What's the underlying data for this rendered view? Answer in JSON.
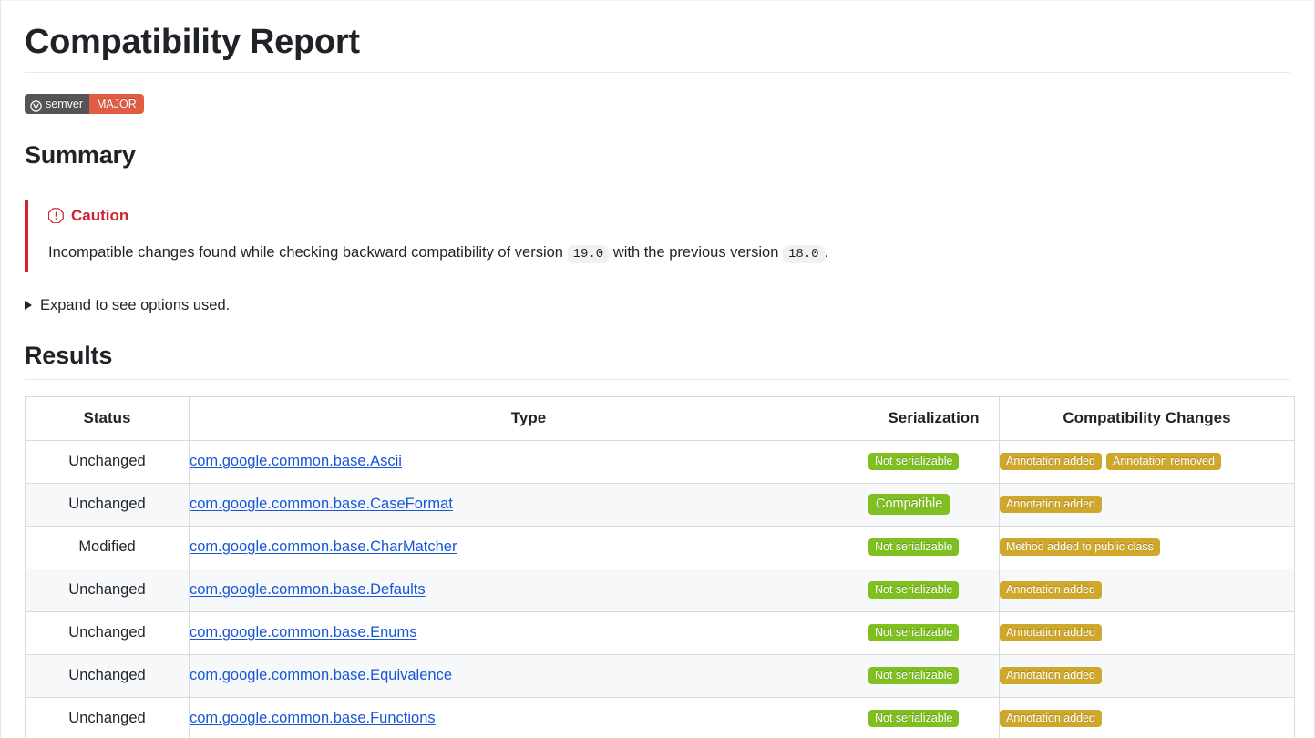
{
  "page": {
    "title": "Compatibility Report"
  },
  "badge": {
    "icon": "semver-circle-v-icon",
    "left_label": "semver",
    "right_label": "MAJOR",
    "left_color": "#555555",
    "right_color": "#e05d44"
  },
  "summary": {
    "heading": "Summary",
    "alert": {
      "icon": "octagon-alert-icon",
      "level_label": "Caution",
      "level_color": "#cf222e",
      "text_before": "Incompatible changes found while checking backward compatibility of version",
      "version_new": "19.0",
      "text_middle": "with the previous version",
      "version_old": "18.0",
      "text_after": "."
    },
    "details_summary": "Expand to see options used."
  },
  "results": {
    "heading": "Results",
    "columns": [
      "Status",
      "Type",
      "Serialization",
      "Compatibility Changes"
    ],
    "rows": [
      {
        "status": "Unchanged",
        "type": "com.google.common.base.Ascii",
        "serialization": {
          "label": "Not serializable",
          "color": "green",
          "size": "small"
        },
        "changes": [
          {
            "label": "Annotation added",
            "color": "yellow"
          },
          {
            "label": "Annotation removed",
            "color": "yellow"
          }
        ]
      },
      {
        "status": "Unchanged",
        "type": "com.google.common.base.CaseFormat",
        "serialization": {
          "label": "Compatible",
          "color": "green",
          "size": "big"
        },
        "changes": [
          {
            "label": "Annotation added",
            "color": "yellow"
          }
        ]
      },
      {
        "status": "Modified",
        "type": "com.google.common.base.CharMatcher",
        "serialization": {
          "label": "Not serializable",
          "color": "green",
          "size": "small"
        },
        "changes": [
          {
            "label": "Method added to public class",
            "color": "yellow"
          }
        ]
      },
      {
        "status": "Unchanged",
        "type": "com.google.common.base.Defaults",
        "serialization": {
          "label": "Not serializable",
          "color": "green",
          "size": "small"
        },
        "changes": [
          {
            "label": "Annotation added",
            "color": "yellow"
          }
        ]
      },
      {
        "status": "Unchanged",
        "type": "com.google.common.base.Enums",
        "serialization": {
          "label": "Not serializable",
          "color": "green",
          "size": "small"
        },
        "changes": [
          {
            "label": "Annotation added",
            "color": "yellow"
          }
        ]
      },
      {
        "status": "Unchanged",
        "type": "com.google.common.base.Equivalence",
        "serialization": {
          "label": "Not serializable",
          "color": "green",
          "size": "small"
        },
        "changes": [
          {
            "label": "Annotation added",
            "color": "yellow"
          }
        ]
      },
      {
        "status": "Unchanged",
        "type": "com.google.common.base.Functions",
        "serialization": {
          "label": "Not serializable",
          "color": "green",
          "size": "small"
        },
        "changes": [
          {
            "label": "Annotation added",
            "color": "yellow"
          }
        ]
      }
    ]
  }
}
